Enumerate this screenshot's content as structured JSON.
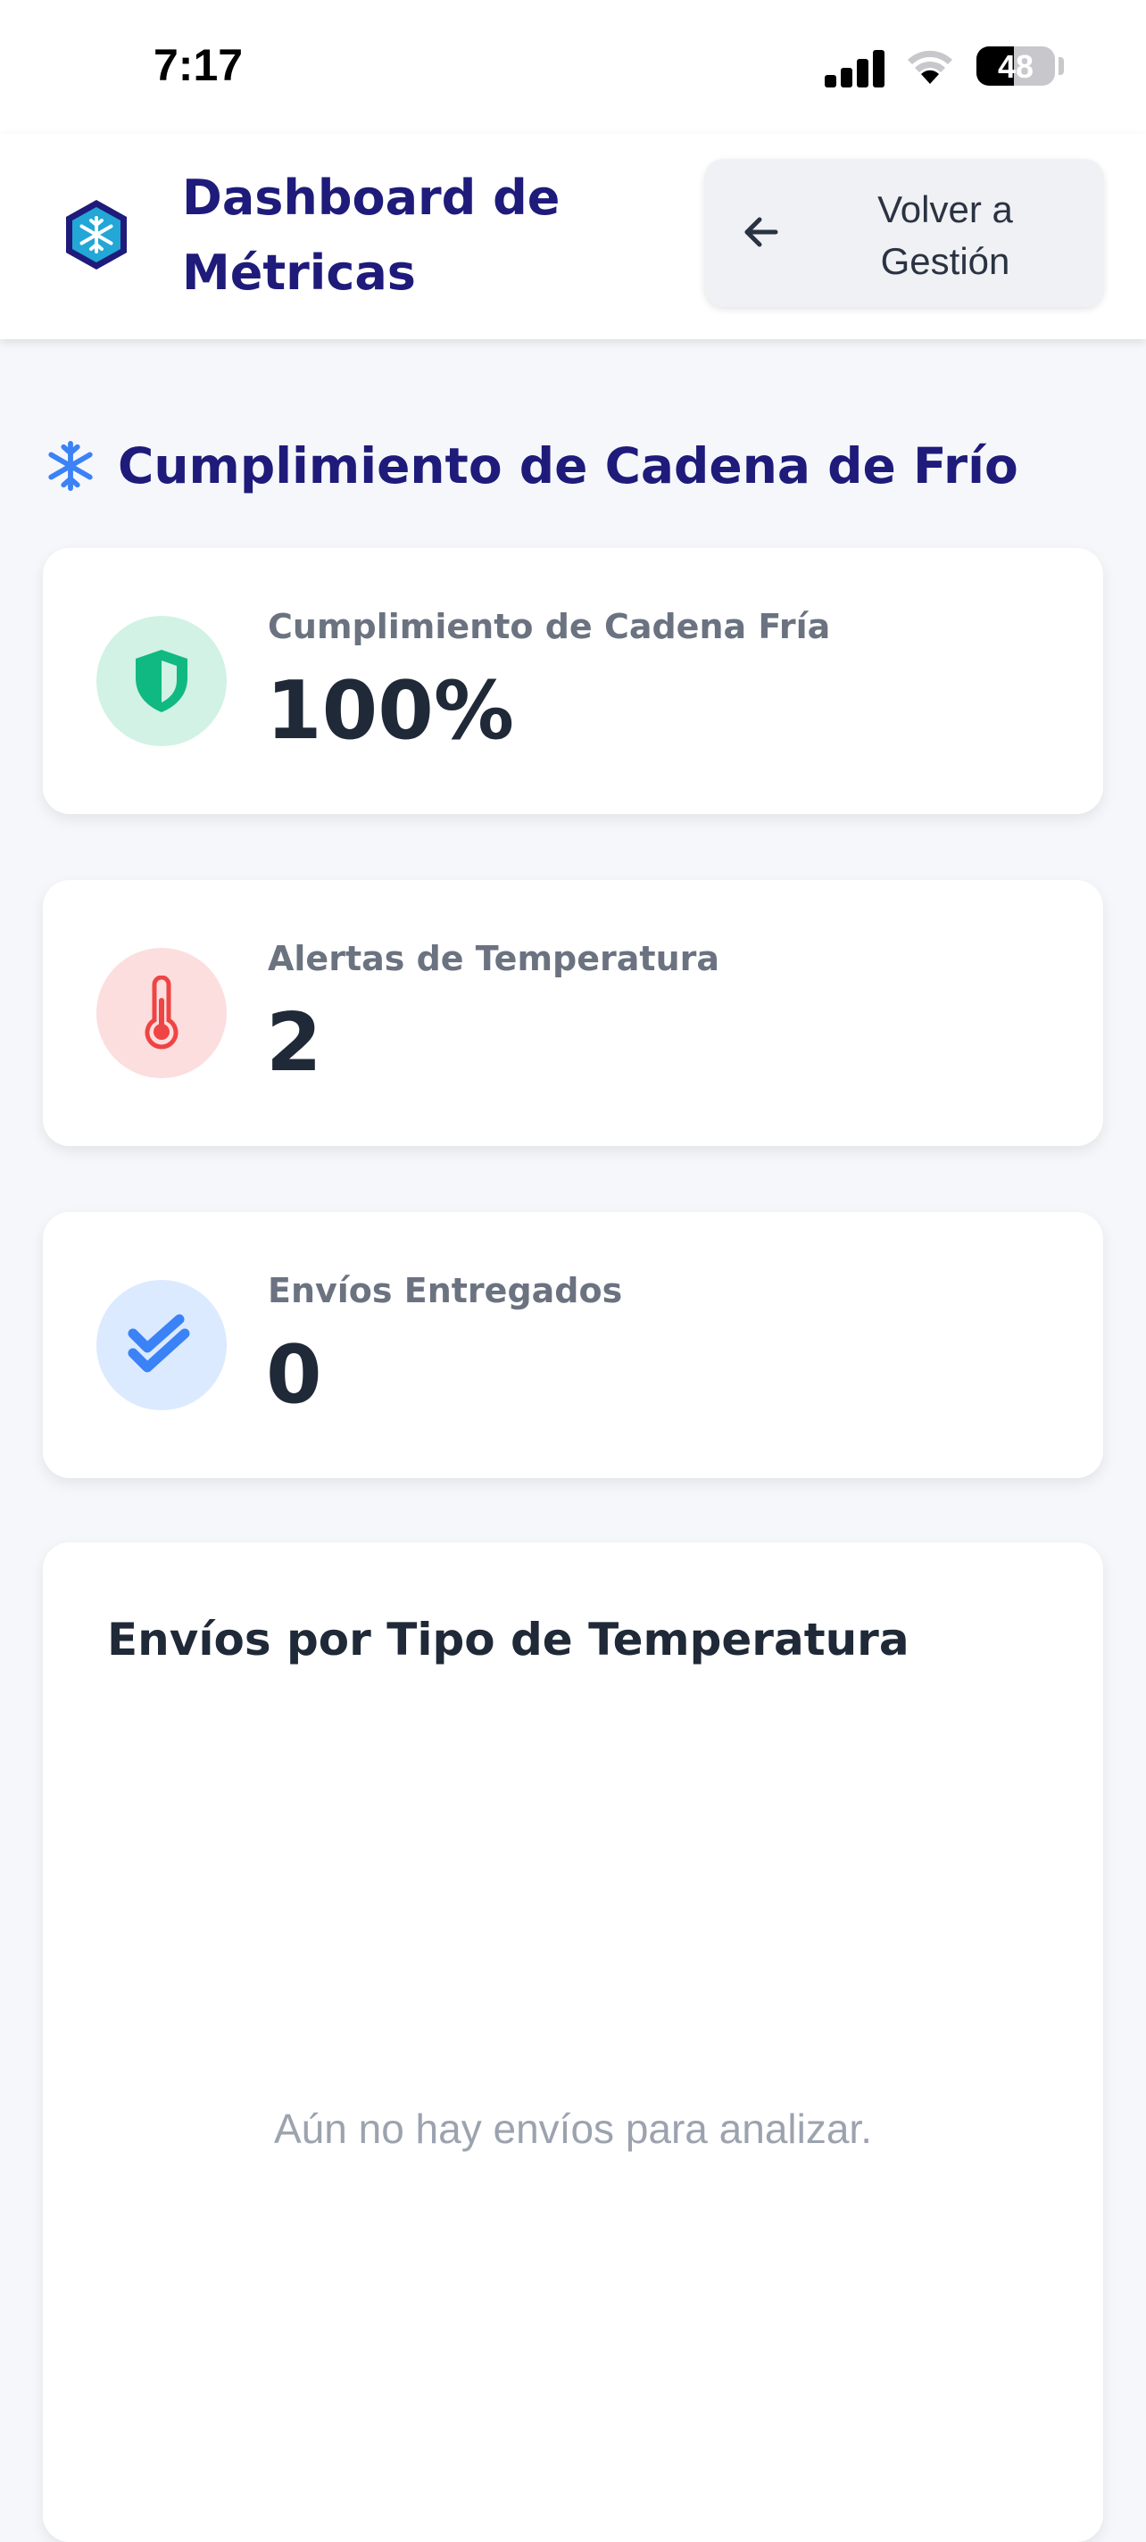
{
  "status_bar": {
    "time": "7:17",
    "battery": "48",
    "battery_level": 0.48
  },
  "header": {
    "title_line1": "Dashboard de",
    "title_line2": "Métricas",
    "back_button_line1": "Volver a",
    "back_button_line2": "Gestión"
  },
  "section": {
    "title": "Cumplimiento de Cadena de Frío"
  },
  "cards": [
    {
      "label": "Cumplimiento de Cadena Fría",
      "value": "100%",
      "icon": "shield-icon",
      "color": "#10b981"
    },
    {
      "label": "Alertas de Temperatura",
      "value": "2",
      "icon": "thermometer-icon",
      "color": "#ef4444"
    },
    {
      "label": "Envíos Entregados",
      "value": "0",
      "icon": "double-check-icon",
      "color": "#3b82f6"
    }
  ],
  "chart_card": {
    "title": "Envíos por Tipo de Temperatura",
    "empty_message": "Aún no hay envíos para analizar."
  },
  "colors": {
    "brand": "#1e1b7b",
    "accent": "#3b82f6",
    "background": "#f5f7fa"
  }
}
